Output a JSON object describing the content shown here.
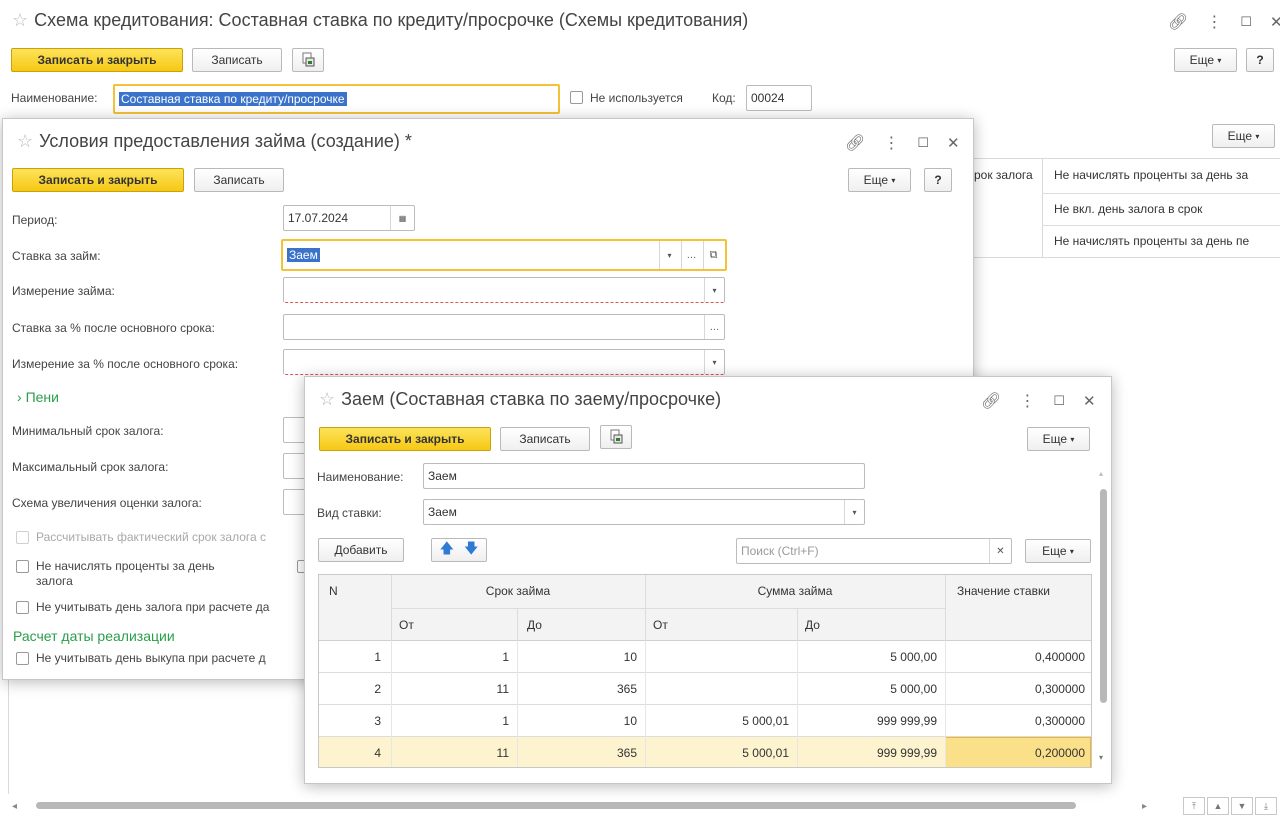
{
  "main": {
    "title": "Схема кредитования: Составная ставка по кредиту/просрочке (Схемы кредитования)",
    "save_close": "Записать и закрыть",
    "save": "Записать",
    "more": "Еще",
    "help": "?",
    "name_label": "Наименование:",
    "name_value": "Составная ставка по кредиту/просрочке",
    "not_used_label": "Не используется",
    "code_label": "Код:",
    "code_value": "00024",
    "table_more": "Еще",
    "table_header_partial": "рок залога",
    "table_cells": [
      "Не начислять проценты за день за",
      "Не вкл. день залога в срок",
      "Не начислять проценты за день пе"
    ]
  },
  "conditions": {
    "title": "Условия предоставления займа (создание) *",
    "save_close": "Записать и закрыть",
    "save": "Записать",
    "more": "Еще",
    "help": "?",
    "period_label": "Период:",
    "period_value": "17.07.2024",
    "rate_label": "Ставка за займ:",
    "rate_value": "Заем",
    "dimension_label": "Измерение займа:",
    "rate_after_label": "Ставка за % после основного срока:",
    "dimension_after_label": "Измерение за % после основного срока:",
    "penalty_group": "Пени",
    "min_term_label": "Минимальный срок залога:",
    "max_term_label": "Максимальный срок залога:",
    "scheme_label": "Схема увеличения оценки залога:",
    "calc_actual_label": "Рассчитывать фактический срок залога с",
    "no_interest_label_1": "Не начислять проценты за день",
    "no_interest_label_2": "залога",
    "ignore_pledge_day_label": "Не учитывать день залога при расчете да",
    "realization_group": "Расчет даты реализации",
    "ignore_buyout_day_label": "Не учитывать день выкупа при расчете д"
  },
  "rate": {
    "title": "Заем (Составная ставка по заему/просрочке)",
    "save_close": "Записать и закрыть",
    "save": "Записать",
    "more": "Еще",
    "name_label": "Наименование:",
    "name_value": "Заем",
    "type_label": "Вид ставки:",
    "type_value": "Заем",
    "add_button": "Добавить",
    "search_placeholder": "Поиск (Ctrl+F)",
    "table_more": "Еще",
    "headers": {
      "n": "N",
      "term": "Срок займа",
      "amount": "Сумма займа",
      "value": "Значение ставки",
      "from1": "От",
      "to1": "До",
      "from2": "От",
      "to2": "До"
    },
    "rows": [
      {
        "n": "1",
        "term_from": "1",
        "term_to": "10",
        "amt_from": "",
        "amt_to": "5 000,00",
        "value": "0,400000"
      },
      {
        "n": "2",
        "term_from": "11",
        "term_to": "365",
        "amt_from": "",
        "amt_to": "5 000,00",
        "value": "0,300000"
      },
      {
        "n": "3",
        "term_from": "1",
        "term_to": "10",
        "amt_from": "5 000,01",
        "amt_to": "999 999,99",
        "value": "0,300000"
      },
      {
        "n": "4",
        "term_from": "11",
        "term_to": "365",
        "amt_from": "5 000,01",
        "amt_to": "999 999,99",
        "value": "0,200000"
      }
    ]
  },
  "colors": {
    "accent_yellow": "#f6c814",
    "focus_border": "#f3c236",
    "selection": "#3a73c9",
    "green_group": "#2a9e4b",
    "row_highlight": "#fdf3cf"
  }
}
